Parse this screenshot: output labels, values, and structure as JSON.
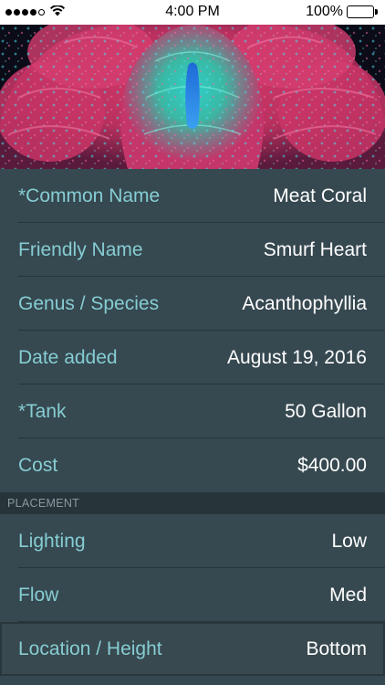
{
  "status_bar": {
    "signal_dots_filled": 4,
    "signal_dots_total": 5,
    "carrier_icon": "wifi-icon",
    "time": "4:00 PM",
    "battery_percent_label": "100%",
    "battery_level": 1.0
  },
  "hero": {
    "image_description_icon": "coral-photo"
  },
  "fields": [
    {
      "label": "*Common Name",
      "value": "Meat Coral"
    },
    {
      "label": "Friendly Name",
      "value": "Smurf Heart"
    },
    {
      "label": "Genus / Species",
      "value": "Acanthophyllia"
    },
    {
      "label": "Date added",
      "value": "August 19, 2016"
    },
    {
      "label": "*Tank",
      "value": "50 Gallon"
    },
    {
      "label": "Cost",
      "value": "$400.00"
    }
  ],
  "placement": {
    "header": "PLACEMENT",
    "fields": [
      {
        "label": "Lighting",
        "value": "Low"
      },
      {
        "label": "Flow",
        "value": "Med"
      },
      {
        "label": "Location / Height",
        "value": "Bottom"
      }
    ]
  },
  "colors": {
    "background": "#364850",
    "label": "#86cdd3",
    "value": "#ffffff",
    "section_header_bg": "#27353b"
  }
}
